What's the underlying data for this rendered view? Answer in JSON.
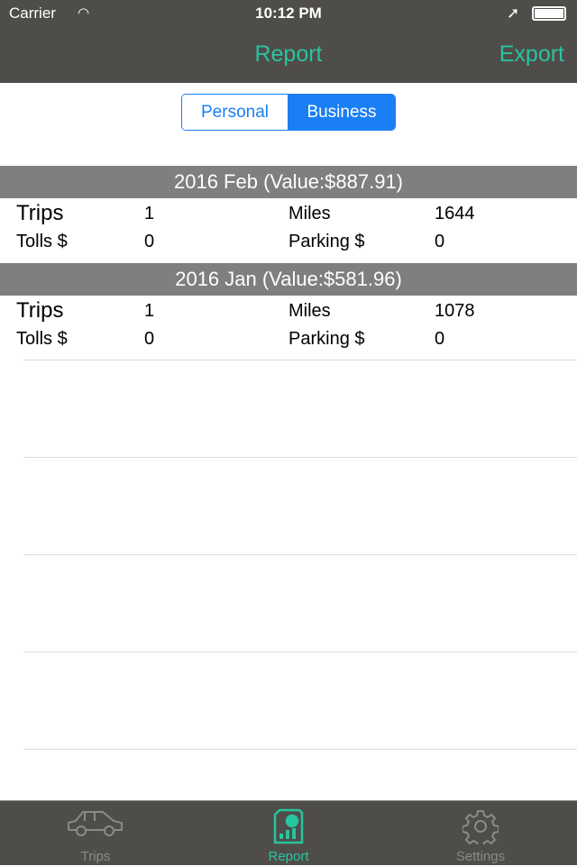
{
  "status": {
    "carrier": "Carrier",
    "time": "10:12 PM"
  },
  "nav": {
    "title": "Report",
    "export": "Export"
  },
  "segment": {
    "options": [
      "Personal",
      "Business"
    ],
    "selected": "Business"
  },
  "sections": [
    {
      "header": "2016 Feb  (Value:$887.91)",
      "trips_label": "Trips",
      "trips": "1",
      "miles_label": "Miles",
      "miles": "1644",
      "tolls_label": "Tolls $",
      "tolls": "0",
      "parking_label": "Parking $",
      "parking": "0"
    },
    {
      "header": "2016 Jan  (Value:$581.96)",
      "trips_label": "Trips",
      "trips": "1",
      "miles_label": "Miles",
      "miles": "1078",
      "tolls_label": "Tolls $",
      "tolls": "0",
      "parking_label": "Parking $",
      "parking": "0"
    }
  ],
  "tabs": [
    {
      "label": "Trips",
      "icon": "car-icon"
    },
    {
      "label": "Report",
      "icon": "report-icon",
      "active": true
    },
    {
      "label": "Settings",
      "icon": "gear-icon"
    }
  ],
  "colors": {
    "accent": "#27c4a0",
    "segment": "#1a7ef5",
    "bar": "#4f4d49"
  }
}
